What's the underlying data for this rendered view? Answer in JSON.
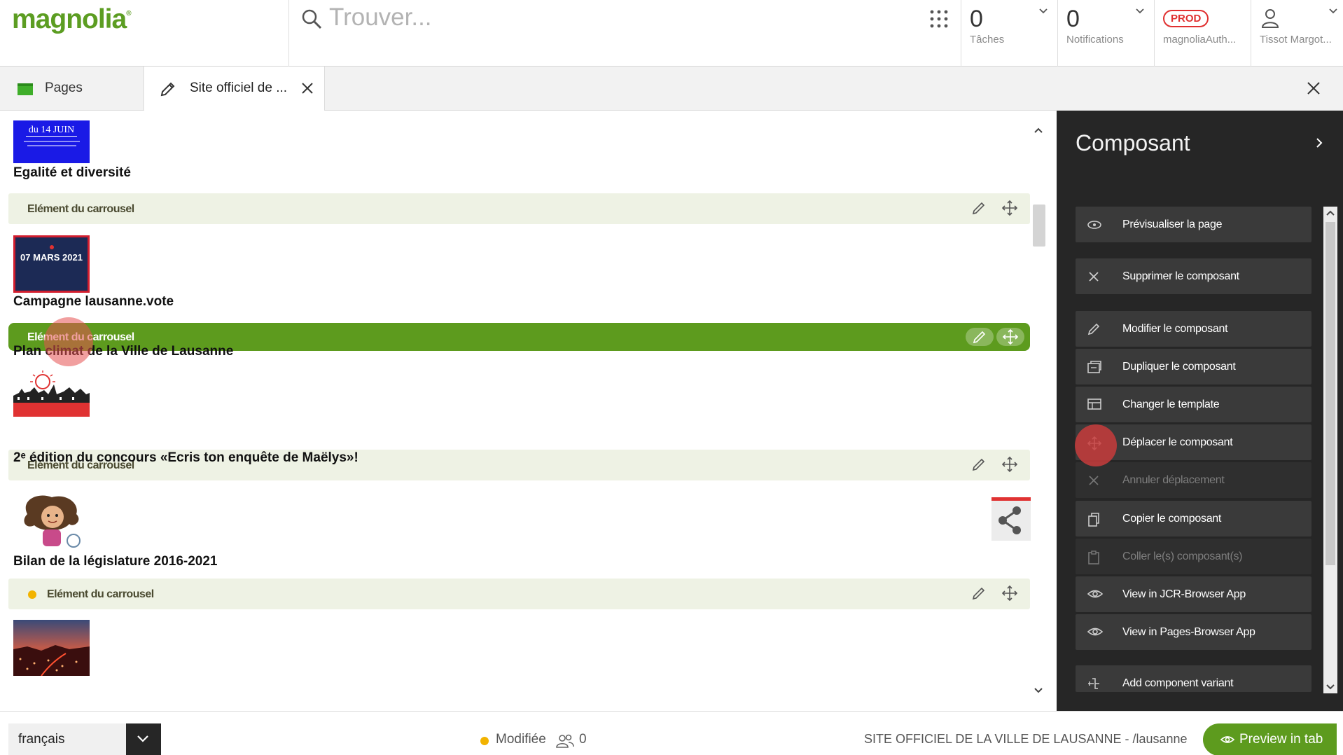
{
  "app": {
    "logo_text": "magnolia",
    "logo_mark": "®",
    "brand_color": "#5c9d22",
    "search_placeholder": "Trouver..."
  },
  "topbar": {
    "tasks": {
      "count": "0",
      "label": "Tâches"
    },
    "notifications": {
      "count": "0",
      "label": "Notifications"
    },
    "environment": {
      "badge": "PROD",
      "label": "magnoliaAuth..."
    },
    "user": {
      "label": "Tissot Margot..."
    }
  },
  "tabs": {
    "pages": "Pages",
    "site": "Site officiel de ..."
  },
  "content": {
    "items": [
      {
        "title": "Egalité et diversité",
        "thumb_text": "du 14 JUIN"
      },
      {
        "title": "Campagne lausanne.vote",
        "thumb_text": "07 MARS 2021"
      },
      {
        "title": "Plan climat de la Ville de Lausanne"
      },
      {
        "title": "2ᵉ édition du concours «Ecris ton enquête de Maëlys»!"
      },
      {
        "title": "Bilan de la législature 2016-2021"
      }
    ],
    "bar_label": "Elément du carrousel",
    "bars": [
      {
        "label": "Elément du carrousel",
        "state": "normal"
      },
      {
        "label": "Elément du carrousel",
        "state": "selected"
      },
      {
        "label": "Elément du carrousel",
        "state": "normal"
      },
      {
        "label": "Elément du carrousel",
        "state": "modified"
      }
    ]
  },
  "panel": {
    "title": "Composant",
    "actions": [
      {
        "label": "Prévisualiser la page",
        "icon": "preview-icon",
        "enabled": true
      },
      {
        "label": "Supprimer le composant",
        "icon": "close-icon",
        "enabled": true
      },
      {
        "label": "Modifier le composant",
        "icon": "pencil-icon",
        "enabled": true
      },
      {
        "label": "Dupliquer le composant",
        "icon": "duplicate-icon",
        "enabled": true
      },
      {
        "label": "Changer le template",
        "icon": "template-icon",
        "enabled": true
      },
      {
        "label": "Déplacer le composant",
        "icon": "move-icon",
        "enabled": true
      },
      {
        "label": "Annuler déplacement",
        "icon": "close-icon",
        "enabled": false
      },
      {
        "label": "Copier le composant",
        "icon": "copy-icon",
        "enabled": true
      },
      {
        "label": "Coller le(s) composant(s)",
        "icon": "clipboard-icon",
        "enabled": false
      },
      {
        "label": "View in JCR-Browser App",
        "icon": "eye-icon",
        "enabled": true
      },
      {
        "label": "View in Pages-Browser App",
        "icon": "eye-icon",
        "enabled": true
      },
      {
        "label": "Add component variant",
        "icon": "variant-icon",
        "enabled": true
      }
    ]
  },
  "footer": {
    "language": "français",
    "status": "Modifiée",
    "users_count": "0",
    "site_path": "SITE OFFICIEL DE LA VILLE DE LAUSANNE - /lausanne",
    "preview_label": "Preview in tab"
  }
}
